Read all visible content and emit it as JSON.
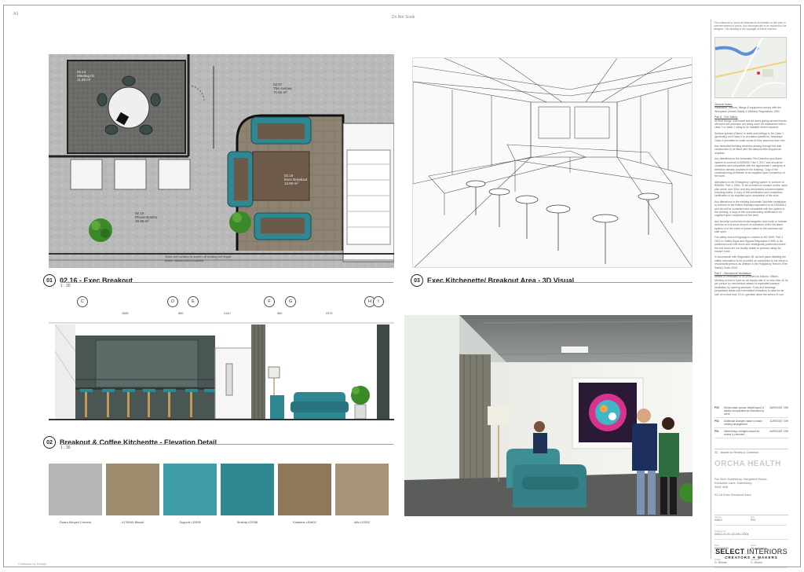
{
  "sheet": {
    "corner_ref": "A3",
    "top_note": "Do Not Scale",
    "footer_ref": "Contracts by Design"
  },
  "plan": {
    "num": "01",
    "title": "02.16 - Exec Breakout",
    "scale": "1 : 30",
    "rooms": [
      {
        "id": "02.14",
        "name": "Meeting 01",
        "area": "11.28 m²"
      },
      {
        "id": "02.07",
        "name": "The Avenue",
        "area": "71.62 m²"
      },
      {
        "id": "02.16",
        "name": "Exec Breakout",
        "area": "12.90 m²"
      },
      {
        "id": "02.15",
        "name": "Phone Booths",
        "area": "10.85 m²"
      }
    ],
    "note": "Sheer net curtains to screen off existing full height timber natural cotton material"
  },
  "visual3d": {
    "num": "03",
    "title": "Exec Kitchenette/ Breakout Area - 3D Visual"
  },
  "elevation": {
    "num": "02",
    "title": "Breakout & Coffee Kitchentte - Elevation Detail",
    "scale": "1 : 30",
    "grid": [
      "C",
      "D",
      "E",
      "F",
      "G",
      "H",
      "I"
    ],
    "dims": [
      "2885",
      "880",
      "2440",
      "680",
      "2575"
    ]
  },
  "materials": [
    {
      "label": "Duaro Alloyed Cement",
      "color": "#b4b5b5"
    },
    {
      "label": "4176045 Biscuit",
      "color": "#9d8c6e"
    },
    {
      "label": "Support LDS05",
      "color": "#3f9da9"
    },
    {
      "label": "Kinship LDS56",
      "color": "#2f8792"
    },
    {
      "label": "Kidstone UDA02",
      "color": "#8f7858"
    },
    {
      "label": "Alfo LDS02",
      "color": "#a89378"
    }
  ],
  "titleblock": {
    "disclaimer": "The contractor to check all dimensions and details on site prior to commencement of works. Any discrepancies to be reported to the designer. This drawing is the copyright of Select Interiors.",
    "notes": [
      {
        "h": "General Notes:",
        "t": "Installation, fixtures, fittings & equipment comply with the Workplace (Health Safety & Welfare) Regulations 1992."
      },
      {
        "h": "Part B - Fire Safety:",
        "t": "All final linings, wall board and all doors giving access thereto will when the premises are being used, be maintained with a class 0 or class 1 rating to be installed where required."
      },
      {
        "h": "",
        "t": "Surface spread of flame to walls and ceilings to be Class 1 (generally) and Class 0 to circulation partitions / stairways. Class 3 permitted to small rooms of floor area less than 4m²."
      },
      {
        "h": "",
        "t": "Any dedicated building services passing through the wall construction to be fitted with fire dampers/fire stopped as required."
      },
      {
        "h": "",
        "t": "Any alterations to the Automatic Fire Detection and Alarm system to conform to BS5839: Part 1: 2017 and should be consistent and compatible with the appropriate L category of detection already provided in the building. Copy of the commissioning certificate to be supplied upon completion of the work."
      },
      {
        "h": "",
        "t": "Alterations to the Emergency Lighting system to conform to BS5266: Part 1: 2016. To be provided on escape routes, open plan areas over 60m² and any windowless accommodation including toilets. A copy of the certification and completion certificates to be supplied upon completion of the work."
      },
      {
        "h": "",
        "t": "Any alterations to the existing Automatic Sprinkler installation to conform to the British Standard equivalent to be BS5306-2 and should be consistent and compatible with the system in the building. A copy of the commissioning certificate to be supplied upon completion of the work."
      },
      {
        "h": "",
        "t": "Any security control electronic/magnetic door locks or release devices on exit doors should on activation of the fire alarm system or in the event of power failure to the premises fail safe open."
      },
      {
        "h": "",
        "t": "Fire safety and exit signage to conform to BS 5499: Part 4 2013 or Safety Signs and Signals Regulations 1996, to be positioned over exit doors and strategically positioned where the exit doors are not readily visible to persons using the escape route."
      },
      {
        "h": "",
        "t": "In accordance with Regulation 38, as built plans detailing the safety information to be provided on completion to the client or responsible person, as defined in the Regulatory Reform (Fire Safety) Order 2005."
      },
      {
        "h": "Part F - Mechanical Ventilation:",
        "t": "Means of ventilation to be provided as follows: Offices, Meeting rooms to have an air supply rate of no less than 10 l/s per person by mechanical means or equivalent passive ventilation by opening windows. Food and beverage preparation areas with intermittent extraction to have an air rate of no less than 15 l/s operable when the area is in use."
      }
    ],
    "revisions": [
      {
        "rev": "P03",
        "desc": "Worksurface pousse height layout & details incorporated as instructed by client",
        "date": "28/09/2020 / DW"
      },
      {
        "rev": "P02",
        "desc": "Additional changes made to match existing arrangement",
        "date": "11/09/2020 / DW"
      },
      {
        "rev": "P01",
        "desc": "Initial design changes issued for review & comment",
        "date": "04/09/2020 / DW"
      }
    ],
    "status": "S2 - Issued for Review & Comment",
    "client": "ORCHA HEALTH",
    "address": [
      "Sci-Tech Daresbury, Vanguard House,",
      "Keckwick Lane, Daresbury",
      "WA4 4AB"
    ],
    "drawing_title": "02.16 Exec Breakout Area",
    "job_no": "00821",
    "drawing_no": "00821-SI-XX-02-DR-I-0004",
    "revision": "P03",
    "date": "02/09/2020",
    "scale": "As indicated",
    "drawn": "D. Woods",
    "checked": "C. Brown",
    "labels": {
      "job": "Job No.",
      "dwg": "Drawing No.",
      "rev": "Rev",
      "date": "Date",
      "scale": "Scale",
      "drawn": "Drawn",
      "checked": "Checked"
    },
    "logo_main": "SELECT",
    "logo_sub": "INTERIORS",
    "logo_tag": "CREATORS ✦ MAKERS"
  },
  "colors": {
    "teal": "#2f8792",
    "carpet": "#5a5c58",
    "concrete": "#b8b8b8",
    "plant": "#3b8a2a"
  }
}
